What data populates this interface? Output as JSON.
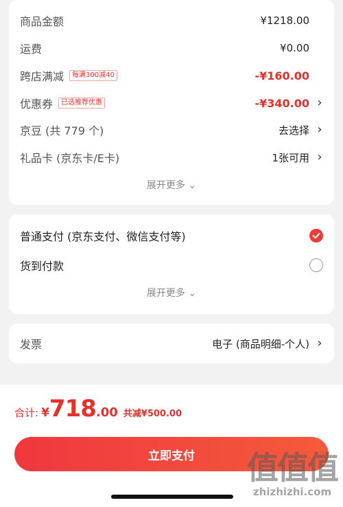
{
  "summary": {
    "goods_amount": {
      "label": "商品金额",
      "value": "¥1218.00"
    },
    "shipping": {
      "label": "运费",
      "value": "¥0.00"
    },
    "cross_store": {
      "label": "跨店满减",
      "tag": "每满300减40",
      "value": "-¥160.00"
    },
    "coupon": {
      "label": "优惠券",
      "tag": "已选推荐优惠",
      "value": "-¥340.00"
    },
    "jingdou": {
      "label": "京豆 (共 779 个)",
      "value": "去选择"
    },
    "gift_card": {
      "label": "礼品卡 (京东卡/E卡)",
      "value": "1张可用"
    },
    "expand": "展开更多"
  },
  "payment": {
    "options": [
      {
        "label": "普通支付 (京东支付、微信支付等)",
        "selected": true
      },
      {
        "label": "货到付款",
        "selected": false
      }
    ],
    "expand": "展开更多"
  },
  "invoice": {
    "label": "发票",
    "value": "电子 (商品明细-个人)"
  },
  "footer": {
    "total_label": "合计:",
    "currency": "¥",
    "total_int": "718",
    "total_dec": ".00",
    "saving": "共减¥500.00",
    "pay_button": "立即支付"
  },
  "watermark": {
    "text": "值值值",
    "domain": "zhizhizhi.com"
  },
  "colors": {
    "accent": "#e5312b",
    "button": "#f0373f"
  }
}
